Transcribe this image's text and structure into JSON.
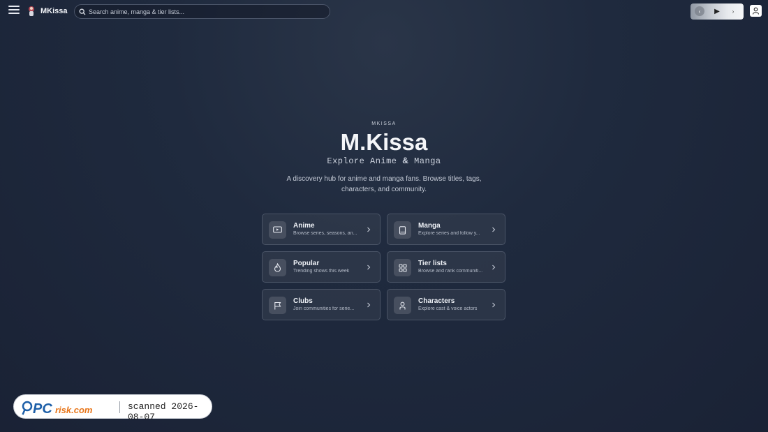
{
  "header": {
    "app_name": "MKissa",
    "search_placeholder": "Search anime, manga & tier lists..."
  },
  "hero": {
    "eyebrow": "MKISSA",
    "title": "M.Kissa",
    "subtitle_left": "Explore Anime",
    "subtitle_amp": "&",
    "subtitle_right": "Manga",
    "description": "A discovery hub for anime and manga fans. Browse titles, tags, characters, and community."
  },
  "cards": [
    {
      "title": "Anime",
      "desc": "Browse series, seasons, an...",
      "icon": "tv-icon"
    },
    {
      "title": "Manga",
      "desc": "Explore series and follow y...",
      "icon": "book-icon"
    },
    {
      "title": "Popular",
      "desc": "Trending shows this week",
      "icon": "flame-icon"
    },
    {
      "title": "Tier lists",
      "desc": "Browse and rank communiti...",
      "icon": "grid-icon"
    },
    {
      "title": "Clubs",
      "desc": "Join communities for serie...",
      "icon": "flag-icon"
    },
    {
      "title": "Characters",
      "desc": "Explore cast & voice actors",
      "icon": "person-icon"
    }
  ],
  "watermark": {
    "brand": "PCrisk.com",
    "text": "scanned 2026-08-07"
  },
  "colors": {
    "background": "#1f2a3e",
    "card_bg": "#3c4454",
    "text": "#e6e9f0"
  }
}
